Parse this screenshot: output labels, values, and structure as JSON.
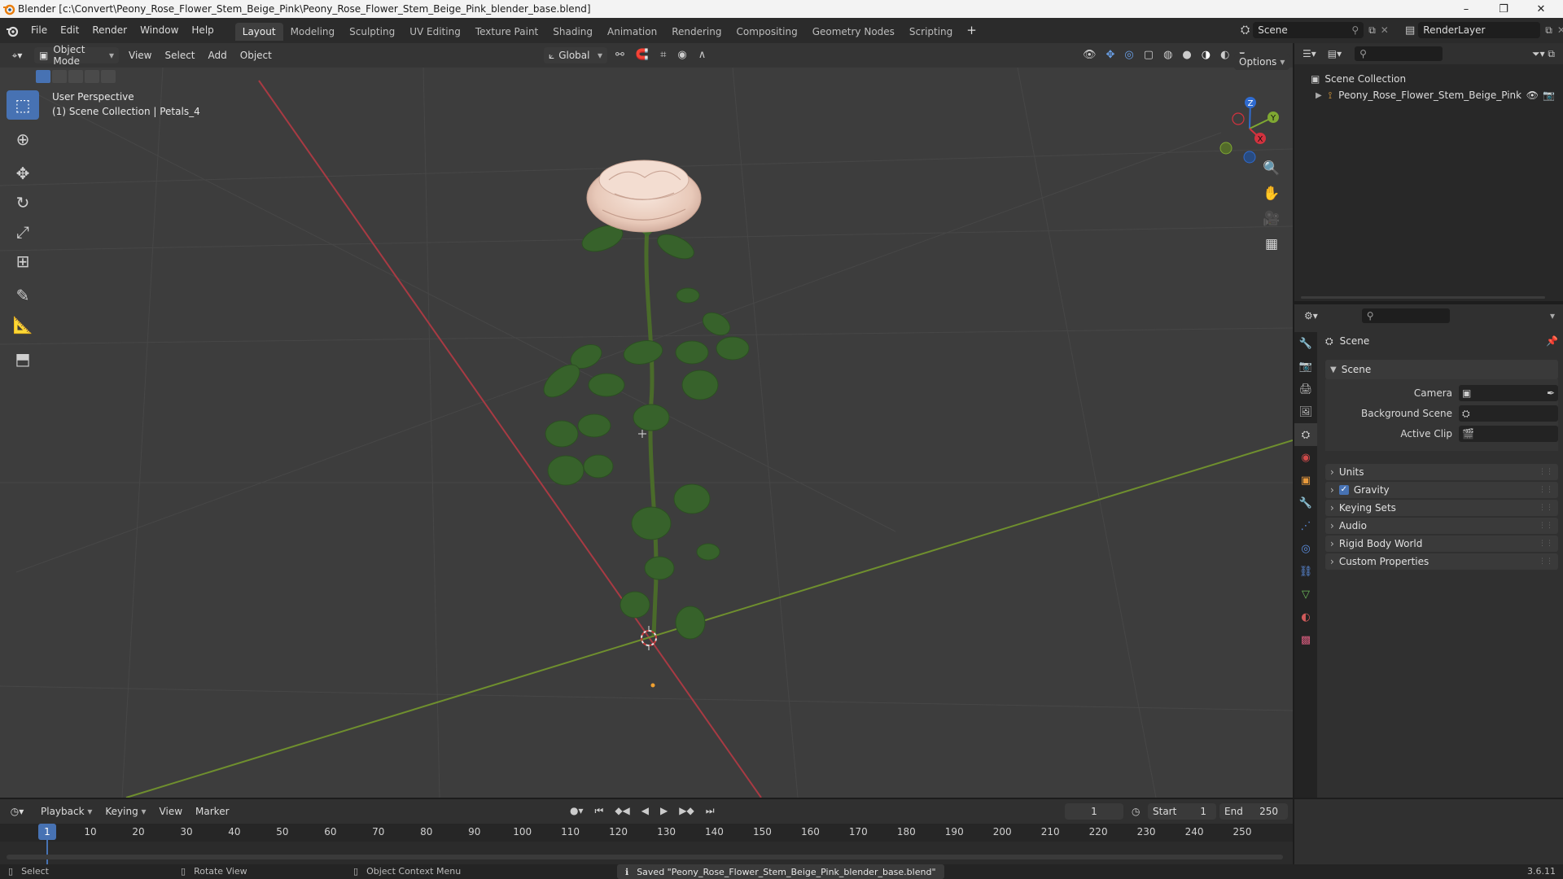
{
  "window": {
    "title": "Blender [c:\\Convert\\Peony_Rose_Flower_Stem_Beige_Pink\\Peony_Rose_Flower_Stem_Beige_Pink_blender_base.blend]",
    "minimize": "–",
    "maximize": "❐",
    "close": "✕"
  },
  "menu": [
    "File",
    "Edit",
    "Render",
    "Window",
    "Help"
  ],
  "workspaces": [
    "Layout",
    "Modeling",
    "Sculpting",
    "UV Editing",
    "Texture Paint",
    "Shading",
    "Animation",
    "Rendering",
    "Compositing",
    "Geometry Nodes",
    "Scripting"
  ],
  "workspace_add": "+",
  "scene_selector": {
    "label": "Scene"
  },
  "view_layer_selector": {
    "label": "RenderLayer"
  },
  "viewport_header": {
    "mode": "Object Mode",
    "items": [
      "View",
      "Select",
      "Add",
      "Object"
    ],
    "orientation": "Global",
    "options": "Options"
  },
  "viewport": {
    "perspective": "User Perspective",
    "collection": "(1) Scene Collection | Petals_4",
    "gizmo": {
      "x": "X",
      "y": "Y",
      "z": "Z"
    }
  },
  "outliner": {
    "root": "Scene Collection",
    "object": "Peony_Rose_Flower_Stem_Beige_Pink"
  },
  "properties": {
    "header": "Scene",
    "panel_scene": "Scene",
    "camera_label": "Camera",
    "background_scene_label": "Background Scene",
    "active_clip_label": "Active Clip",
    "panels": [
      "Units",
      "Gravity",
      "Keying Sets",
      "Audio",
      "Rigid Body World",
      "Custom Properties"
    ],
    "gravity_checked": true
  },
  "timeline": {
    "menus": [
      "Playback",
      "Keying",
      "View",
      "Marker"
    ],
    "current_frame": "1",
    "start_label": "Start",
    "start": "1",
    "end_label": "End",
    "end": "250",
    "frames": [
      "1",
      "10",
      "20",
      "30",
      "40",
      "50",
      "60",
      "70",
      "80",
      "90",
      "100",
      "110",
      "120",
      "130",
      "140",
      "150",
      "160",
      "170",
      "180",
      "190",
      "200",
      "210",
      "220",
      "230",
      "240",
      "250"
    ]
  },
  "statusbar": {
    "select": "Select",
    "rotate": "Rotate View",
    "context": "Object Context Menu",
    "message": "Saved \"Peony_Rose_Flower_Stem_Beige_Pink_blender_base.blend\"",
    "version": "3.6.11"
  },
  "colors": {
    "accent": "#4772b3",
    "x_axis": "#c23b46",
    "y_axis": "#7a9e32",
    "petal": "#eed2c4",
    "leaf": "#3d6a2f",
    "blender_orange": "#e87d0d"
  }
}
